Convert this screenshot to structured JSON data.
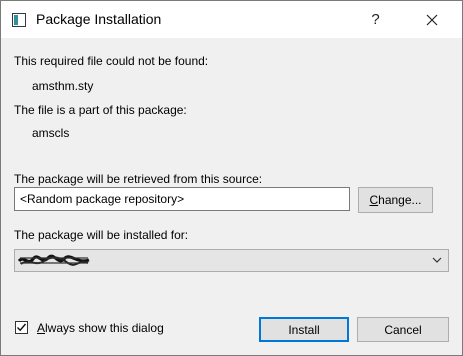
{
  "window": {
    "title": "Package Installation",
    "help_symbol": "?",
    "close_symbol": "✕"
  },
  "missing_file": {
    "label": "This required file could not be found:",
    "value": "amsthm.sty"
  },
  "package": {
    "label": "The file is a part of this package:",
    "value": "amscls"
  },
  "source": {
    "label": "The package will be retrieved from this source:",
    "value": "<Random package repository>",
    "change_button_mnemonic": "C",
    "change_button_rest": "hange..."
  },
  "install_for": {
    "label": "The package will be installed for:",
    "selected": "(obscured)"
  },
  "footer": {
    "checkbox_mnemonic": "A",
    "checkbox_rest": "lways show this dialog",
    "checkbox_checked": true,
    "install_button": "Install",
    "cancel_button": "Cancel"
  },
  "colors": {
    "title_bg": "#ffffff",
    "dialog_bg": "#f0f0f0",
    "default_button_border": "#0078d7"
  },
  "icons": [
    "app-icon",
    "help-icon",
    "close-icon",
    "chevron-down-icon",
    "checkmark-icon"
  ]
}
